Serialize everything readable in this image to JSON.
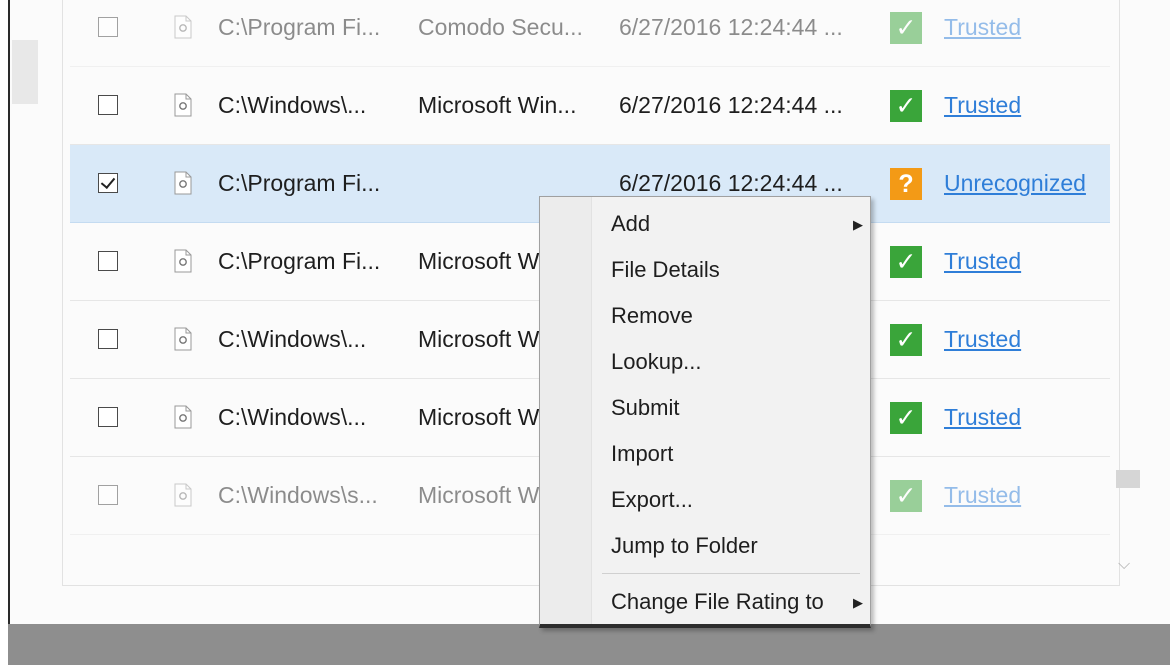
{
  "rows": [
    {
      "checked": false,
      "faded": true,
      "path": "C:\\Program Fi...",
      "vendor": "Comodo Secu...",
      "date": "6/27/2016 12:24:44 ...",
      "rating_icon": "check-icon",
      "rating": "Trusted"
    },
    {
      "checked": false,
      "faded": false,
      "path": "C:\\Windows\\...",
      "vendor": "Microsoft Win...",
      "date": "6/27/2016 12:24:44 ...",
      "rating_icon": "check-icon",
      "rating": "Trusted"
    },
    {
      "checked": true,
      "selected": true,
      "faded": false,
      "path": "C:\\Program Fi...",
      "vendor": "",
      "date": "6/27/2016 12:24:44 ...",
      "rating_icon": "question-icon",
      "rating": "Unrecognized"
    },
    {
      "checked": false,
      "faded": false,
      "path": "C:\\Program Fi...",
      "vendor": "Microsoft W",
      "date": "",
      "rating_icon": "check-icon",
      "rating": "Trusted"
    },
    {
      "checked": false,
      "faded": false,
      "path": "C:\\Windows\\...",
      "vendor": "Microsoft W",
      "date": "",
      "rating_icon": "check-icon",
      "rating": "Trusted"
    },
    {
      "checked": false,
      "faded": false,
      "path": "C:\\Windows\\...",
      "vendor": "Microsoft W",
      "date": "",
      "rating_icon": "check-icon",
      "rating": "Trusted"
    },
    {
      "checked": false,
      "faded": true,
      "path": "C:\\Windows\\s...",
      "vendor": "Microsoft W",
      "date": "",
      "rating_icon": "check-icon",
      "rating": "Trusted"
    }
  ],
  "context_menu": {
    "items": [
      "Add",
      "File Details",
      "Remove",
      "Lookup...",
      "Submit",
      "Import",
      "Export...",
      "Jump to Folder",
      "Change File Rating to"
    ],
    "submenu_items": [
      "Add",
      "Change File Rating to"
    ]
  },
  "badge_glyphs": {
    "check": "✓",
    "question": "?"
  },
  "colors": {
    "trusted": "#3aa53a",
    "unrecognized": "#f39a16",
    "link": "#2f7ed8",
    "selected_row": "#d9e9f8"
  }
}
